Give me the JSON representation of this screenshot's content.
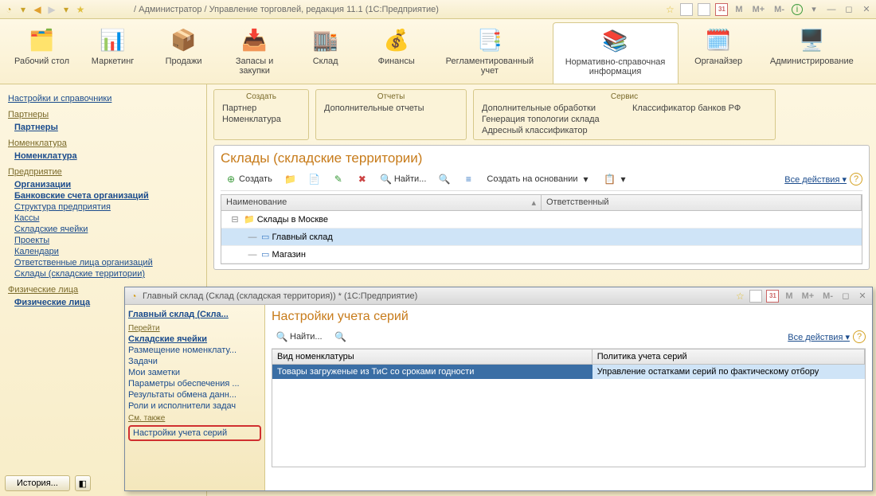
{
  "titlebar": {
    "title": "/ Администратор / Управление торговлей, редакция 11.1  (1С:Предприятие)",
    "m": "M",
    "mplus": "M+",
    "mminus": "M-",
    "cal": "31"
  },
  "toolbar": {
    "items": [
      {
        "label": "Рабочий\nстол"
      },
      {
        "label": "Маркетинг"
      },
      {
        "label": "Продажи"
      },
      {
        "label": "Запасы и\nзакупки"
      },
      {
        "label": "Склад"
      },
      {
        "label": "Финансы"
      },
      {
        "label": "Регламентированный\nучет"
      },
      {
        "label": "Нормативно-справочная\nинформация"
      },
      {
        "label": "Органайзер"
      },
      {
        "label": "Администрирование"
      }
    ]
  },
  "leftnav": {
    "g0": "Настройки и справочники",
    "g1": "Партнеры",
    "g1a": "Партнеры",
    "g2": "Номенклатура",
    "g2a": "Номенклатура",
    "g3": "Предприятие",
    "g3a": "Организации",
    "g3b": "Банковские счета организаций",
    "g3c": "Структура предприятия",
    "g3d": "Кассы",
    "g3e": "Складские ячейки",
    "g3f": "Проекты",
    "g3g": "Календари",
    "g3h": "Ответственные лица организаций",
    "g3i": "Склады (складские территории)",
    "g4": "Физические лица",
    "g4a": "Физические лица",
    "history": "История..."
  },
  "panels": {
    "create": {
      "title": "Создать",
      "i1": "Партнер",
      "i2": "Номенклатура"
    },
    "reports": {
      "title": "Отчеты",
      "i1": "Дополнительные отчеты"
    },
    "service": {
      "title": "Сервис",
      "c1": "Дополнительные обработки",
      "c2": "Генерация топологии склада",
      "c3": "Адресный классификатор",
      "c4": "Классификатор банков РФ"
    }
  },
  "main": {
    "title": "Склады (складские территории)",
    "btn_create": "Создать",
    "btn_find": "Найти...",
    "btn_base": "Создать на основании",
    "btn_all": "Все действия",
    "col1": "Наименование",
    "col2": "Ответственный",
    "r0": "Склады в Москве",
    "r1": "Главный склад",
    "r2": "Магазин"
  },
  "subwin": {
    "title": "Главный склад (Склад (складская территория)) *  (1С:Предприятие)",
    "cal": "31",
    "m": "M",
    "mplus": "M+",
    "mminus": "M-",
    "nav_title": "Главный склад (Скла...",
    "nav_head1": "Перейти",
    "l1": "Складские ячейки",
    "l2": "Размещение номенклату...",
    "l3": "Задачи",
    "l4": "Мои заметки",
    "l5": "Параметры обеспечения ...",
    "l6": "Результаты обмена данн...",
    "l7": "Роли и исполнители задач",
    "nav_head2": "См. также",
    "l8": "Настройки учета серий",
    "right_title": "Настройки учета серий",
    "btn_find": "Найти...",
    "btn_all": "Все действия",
    "col1": "Вид номенклатуры",
    "col2": "Политика учета серий",
    "row_c1": "Товары загруженые из ТиС со сроками годности",
    "row_c2": "Управление остатками серий по фактическому отбору"
  }
}
